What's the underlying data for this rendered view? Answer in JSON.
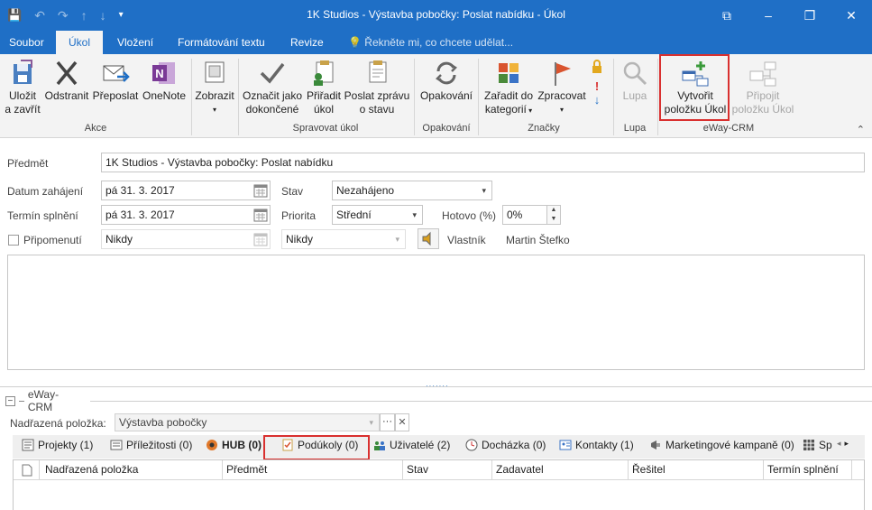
{
  "window": {
    "title": "1K Studios - Výstavba pobočky: Poslat nabídku - Úkol",
    "minimize": "–",
    "restore": "❐",
    "close": "✕",
    "ribbon_options": "⧉"
  },
  "qat": {
    "save": "💾",
    "undo": "↶",
    "redo": "↷",
    "up": "↑",
    "down": "↓",
    "more": "▾"
  },
  "tabs": [
    {
      "label": "Soubor"
    },
    {
      "label": "Úkol"
    },
    {
      "label": "Vložení"
    },
    {
      "label": "Formátování textu"
    },
    {
      "label": "Revize"
    },
    {
      "label": "Řekněte mi, co chcete udělat..."
    }
  ],
  "ribbon": {
    "save_close": [
      "Uložit",
      "a zavřít"
    ],
    "delete": "Odstranit",
    "forward": "Přeposlat",
    "onenote": "OneNote",
    "group_actions": "Akce",
    "show": "Zobrazit",
    "mark_done": [
      "Označit jako",
      "dokončené"
    ],
    "assign": [
      "Přiřadit",
      "úkol"
    ],
    "send_status": [
      "Poslat zprávu",
      "o stavu"
    ],
    "group_manage": "Spravovat úkol",
    "recurrence": "Opakování",
    "group_recurrence": "Opakování",
    "categorize": [
      "Zařadit do",
      "kategorií"
    ],
    "follow_up": "Zpracovat",
    "group_tags": "Značky",
    "zoom": "Lupa",
    "group_zoom": "Lupa",
    "create_task": [
      "Vytvořit",
      "položku Úkol"
    ],
    "attach_task": [
      "Připojit",
      "položku Úkol"
    ],
    "group_eway": "eWay-CRM"
  },
  "form": {
    "subject_label": "Předmět",
    "subject_value": "1K Studios - Výstavba pobočky: Poslat nabídku",
    "start_label": "Datum zahájení",
    "start_value": "pá 31. 3. 2017",
    "due_label": "Termín splnění",
    "due_value": "pá 31. 3. 2017",
    "reminder_label": "Připomenutí",
    "reminder_date": "Nikdy",
    "reminder_time": "Nikdy",
    "status_label": "Stav",
    "status_value": "Nezahájeno",
    "priority_label": "Priorita",
    "priority_value": "Střední",
    "done_label": "Hotovo (%)",
    "done_value": "0%",
    "owner_label": "Vlastník",
    "owner_value": "Martin Štefko"
  },
  "eway": {
    "section_title": "eWay-CRM",
    "parent_label": "Nadřazená položka:",
    "parent_value": "Výstavba pobočky",
    "subtabs": [
      {
        "label": "Projekty (1)"
      },
      {
        "label": "Příležitosti (0)"
      },
      {
        "label": "HUB (0)"
      },
      {
        "label": "Podúkoly (0)"
      },
      {
        "label": "Uživatelé (2)"
      },
      {
        "label": "Docházka (0)"
      },
      {
        "label": "Kontakty (1)"
      },
      {
        "label": "Marketingové kampaně (0)"
      },
      {
        "label": "Sp"
      }
    ],
    "columns": [
      "Nadřazená položka",
      "Předmět",
      "Stav",
      "Zadavatel",
      "Řešitel",
      "Termín splnění"
    ]
  }
}
